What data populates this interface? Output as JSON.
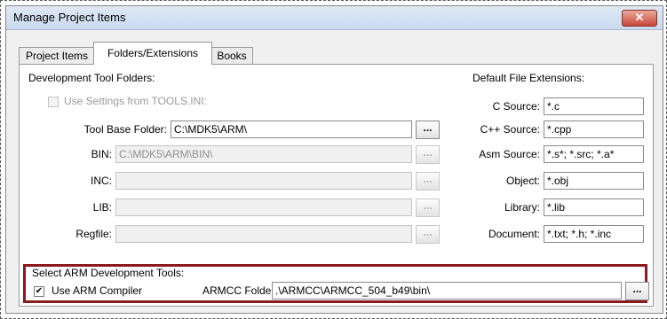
{
  "window": {
    "title": "Manage Project Items",
    "close_glyph": "✕"
  },
  "tabs": [
    {
      "label": "Project Items",
      "active": false
    },
    {
      "label": "Folders/Extensions",
      "active": true
    },
    {
      "label": "Books",
      "active": false
    }
  ],
  "folders": {
    "heading": "Development Tool Folders:",
    "use_tools_ini": {
      "label": "Use Settings from TOOLS.INI:",
      "checked": false,
      "enabled": false
    },
    "rows": [
      {
        "label": "Tool Base Folder:",
        "value": "C:\\MDK5\\ARM\\",
        "enabled": true
      },
      {
        "label": "BIN:",
        "value": "C:\\MDK5\\ARM\\BIN\\",
        "enabled": false
      },
      {
        "label": "INC:",
        "value": "",
        "enabled": false
      },
      {
        "label": "LIB:",
        "value": "",
        "enabled": false
      },
      {
        "label": "Regfile:",
        "value": "",
        "enabled": false
      }
    ],
    "browse_label": "..."
  },
  "extensions": {
    "heading": "Default File Extensions:",
    "rows": [
      {
        "label": "C Source:",
        "value": "*.c"
      },
      {
        "label": "C++ Source:",
        "value": "*.cpp"
      },
      {
        "label": "Asm Source:",
        "value": "*.s*; *.src; *.a*"
      },
      {
        "label": "Object:",
        "value": "*.obj"
      },
      {
        "label": "Library:",
        "value": "*.lib"
      },
      {
        "label": "Document:",
        "value": "*.txt; *.h; *.inc"
      }
    ]
  },
  "arm_tools": {
    "heading": "Select ARM Development Tools:",
    "use_arm_compiler": {
      "label": "Use ARM Compiler",
      "checked": true,
      "check_glyph": "✔"
    },
    "armcc_label": "ARMCC Folder:",
    "armcc_value": ".\\ARMCC\\ARMCC_504_b49\\bin\\",
    "browse_label": "...",
    "highlight_color": "#8b1a1f"
  }
}
